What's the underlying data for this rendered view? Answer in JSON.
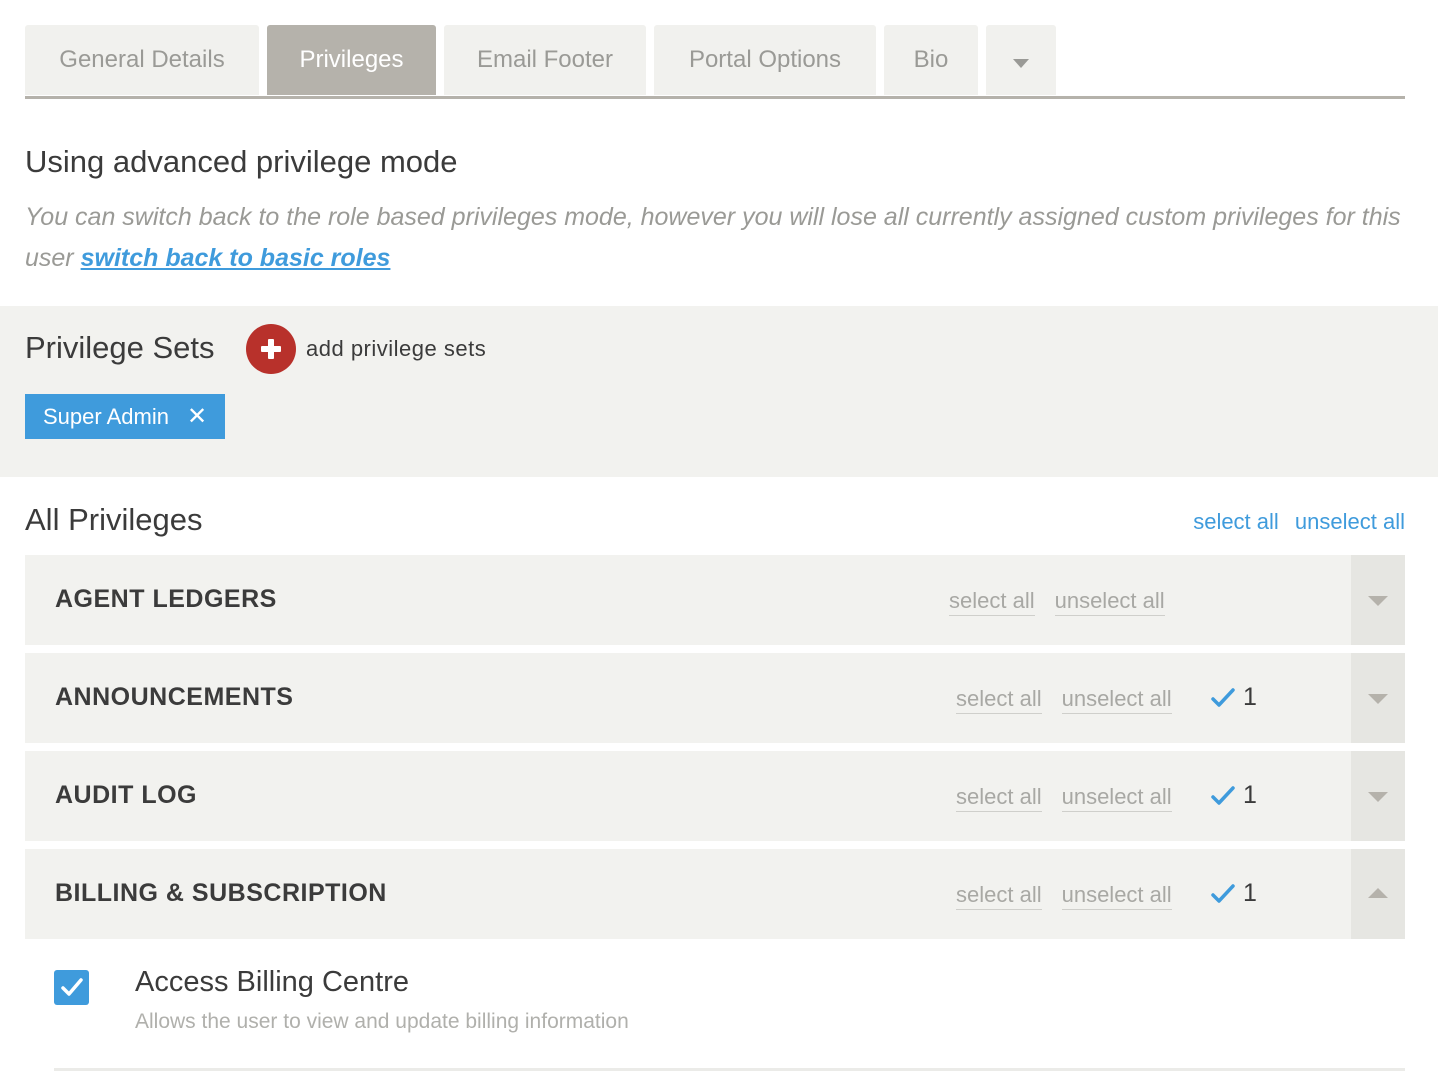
{
  "tabs": [
    {
      "label": "General Details"
    },
    {
      "label": "Privileges",
      "active": true
    },
    {
      "label": "Email Footer"
    },
    {
      "label": "Portal Options"
    },
    {
      "label": "Bio"
    }
  ],
  "mode": {
    "title": "Using advanced privilege mode",
    "description": "You can switch back to the role based privileges mode, however you will lose all currently assigned custom privileges for this user",
    "link": "switch back to basic roles"
  },
  "privilege_sets": {
    "title": "Privilege Sets",
    "add_label": "add privilege sets",
    "tags": [
      {
        "label": "Super Admin",
        "remove": "✕"
      }
    ]
  },
  "all_privileges": {
    "title": "All Privileges",
    "select_all": "select all",
    "unselect_all": "unselect all"
  },
  "groups": [
    {
      "name": "AGENT LEDGERS",
      "select_all": "select all",
      "unselect_all": "unselect all",
      "count": "",
      "expanded": false
    },
    {
      "name": "ANNOUNCEMENTS",
      "select_all": "select all",
      "unselect_all": "unselect all",
      "count": "1",
      "expanded": false
    },
    {
      "name": "AUDIT LOG",
      "select_all": "select all",
      "unselect_all": "unselect all",
      "count": "1",
      "expanded": false
    },
    {
      "name": "BILLING & SUBSCRIPTION",
      "select_all": "select all",
      "unselect_all": "unselect all",
      "count": "1",
      "expanded": true
    }
  ],
  "privilege_item": {
    "title": "Access Billing Centre",
    "description": "Allows the user to view and update billing information",
    "checked": true
  },
  "colors": {
    "accent_blue": "#3f9bdc",
    "add_red": "#b8312b",
    "tab_active": "#b5b2ab",
    "panel_bg": "#f2f2ef"
  }
}
